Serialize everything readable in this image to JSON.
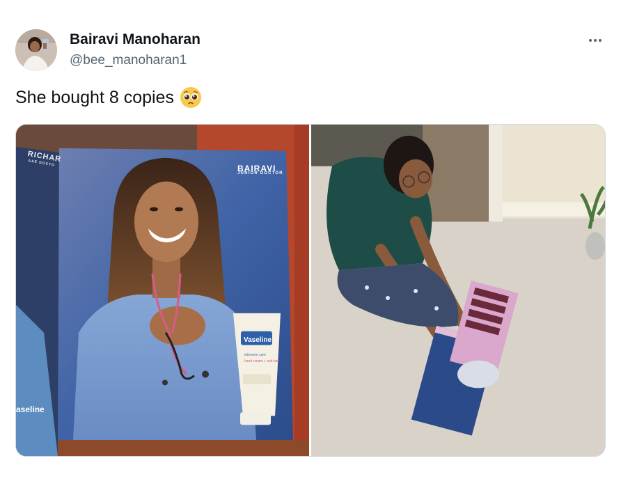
{
  "author": {
    "name": "Bairavi Manoharan",
    "handle": "@bee_manoharan1"
  },
  "tweet": {
    "text": "She bought 8 copies",
    "emoji": "pleading-face-emoji"
  },
  "media": {
    "left_photo": {
      "ad_name": "BAIRAVI",
      "ad_role": "JUNIOR DOCTOR",
      "facing_page_text": "RICHAR",
      "facing_page_subtext": "A&E DOCTO",
      "tube_brand": "Vaseline",
      "tube_line1": "intensive care",
      "tube_line2": "hand cream + anti-bac",
      "facing_page_brand": "aseline"
    },
    "right_photo": {}
  },
  "colors": {
    "text_primary": "#0f1419",
    "text_secondary": "#536471",
    "border": "#cfd9de"
  }
}
